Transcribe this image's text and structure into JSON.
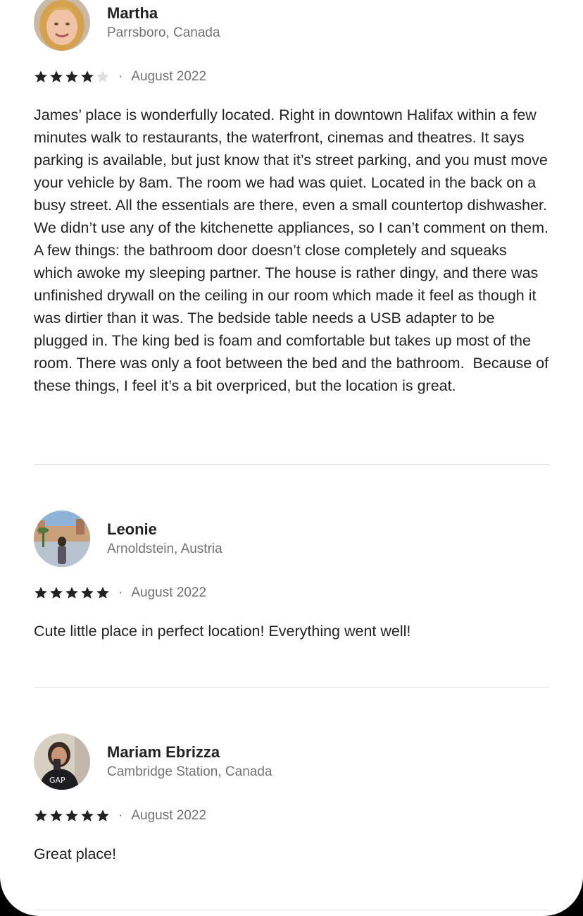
{
  "reviews": [
    {
      "name": "Martha",
      "location": "Parrsboro, Canada",
      "rating": 4,
      "max_rating": 5,
      "separator": "·",
      "date": "August 2022",
      "text": "James’ place is wonderfully located. Right in downtown Halifax within a few minutes walk to restaurants, the waterfront, cinemas and theatres. It says parking is available, but just know that it’s street parking, and you must move your vehicle by 8am. The room we had was quiet. Located in the back on a busy street. All the essentials are there, even a small countertop dishwasher. We didn’t use any of the kitchenette appliances, so I can’t comment on them. A few things: the bathroom door doesn’t close completely and squeaks which awoke my sleeping partner. The house is rather dingy, and there was unfinished drywall on the ceiling in our room which made it feel as though it was dirtier than it was. The bedside table needs a USB adapter to be plugged in. The king bed is foam and comfortable but takes up most of the room. There was only a foot between the bed and the bathroom.  Because of these things, I feel it’s a bit overpriced, but the location is great."
    },
    {
      "name": "Leonie",
      "location": "Arnoldstein, Austria",
      "rating": 5,
      "max_rating": 5,
      "separator": "·",
      "date": "August 2022",
      "text": "Cute little place in perfect location! Everything went well!"
    },
    {
      "name": "Mariam Ebrizza",
      "location": "Cambridge Station, Canada",
      "rating": 5,
      "max_rating": 5,
      "separator": "·",
      "date": "August 2022",
      "text": "Great place!"
    }
  ],
  "colors": {
    "star_filled": "#222222",
    "star_empty": "#dddddd",
    "text_primary": "#222222",
    "text_secondary": "#717171",
    "divider": "#dddddd"
  },
  "icons": {
    "star": "star-icon"
  }
}
